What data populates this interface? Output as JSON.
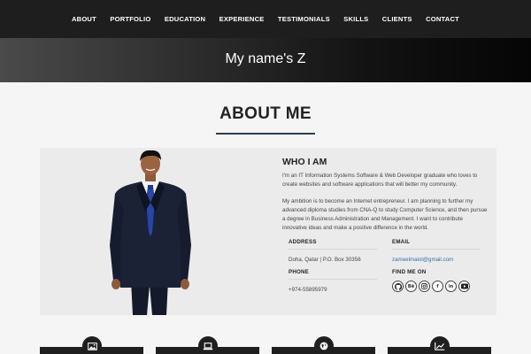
{
  "nav": {
    "items": [
      "ABOUT",
      "PORTFOLIO",
      "EDUCATION",
      "EXPERIENCE",
      "TESTIMONIALS",
      "SKILLS",
      "CLIENTS",
      "CONTACT"
    ]
  },
  "banner": {
    "title": "My name's Z"
  },
  "about": {
    "heading": "ABOUT ME",
    "who_title": "WHO I AM",
    "bio_1": "I'm an IT Information Systems Software & Web Developer graduate who loves to create websites and software applications that will better my community.",
    "bio_2": "My ambition is to become an Internet entrepreneur. I am planning to further my advanced diploma studies from CNA-Q to study Computer Science, and then pursue a degree in Business Administration and Management. I want to contribute innovative ideas and make a positive difference in the world.",
    "address_label": "ADDRESS",
    "address_value": "Doha, Qatar | P.O. Box 30356",
    "email_label": "EMAIL",
    "email_value": "zameelmaiol@gmail.com",
    "phone_label": "PHONE",
    "phone_value": "+974-55895979",
    "find_label": "FIND ME ON",
    "socials": [
      "github-icon",
      "behance-icon",
      "instagram-icon",
      "facebook-icon",
      "linkedin-icon",
      "youtube-icon"
    ]
  },
  "cards": {
    "icons": [
      "image-icon",
      "laptop-icon",
      "globe-icon",
      "chart-icon"
    ]
  },
  "colors": {
    "navbar": "#1e1e1e",
    "accent_underline": "#2c3e50",
    "link": "#3a6ea5"
  }
}
